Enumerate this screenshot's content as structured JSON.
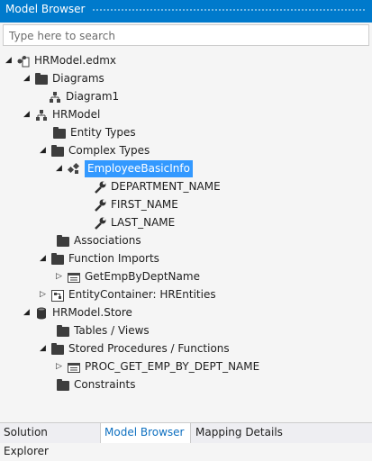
{
  "window": {
    "title": "Model Browser"
  },
  "search": {
    "placeholder": "Type here to search"
  },
  "tree": {
    "root": "HRModel.edmx",
    "diagrams": "Diagrams",
    "diagram1": "Diagram1",
    "hrmodel": "HRModel",
    "entity_types": "Entity Types",
    "complex_types": "Complex Types",
    "employee_basic_info": "EmployeeBasicInfo",
    "department_name": "DEPARTMENT_NAME",
    "first_name": "FIRST_NAME",
    "last_name": "LAST_NAME",
    "associations": "Associations",
    "function_imports": "Function Imports",
    "get_emp_by_dept": "GetEmpByDeptName",
    "entity_container": "EntityContainer: HREntities",
    "store": "HRModel.Store",
    "tables_views": "Tables / Views",
    "stored_procs": "Stored Procedures / Functions",
    "proc_get_emp": "PROC_GET_EMP_BY_DEPT_NAME",
    "constraints": "Constraints"
  },
  "tabs": [
    "Solution Explorer",
    "Model Browser",
    "Mapping Details"
  ],
  "colors": {
    "title_bar": "#007acc",
    "selection": "#3399ff",
    "active_tab_text": "#0e70c0"
  }
}
